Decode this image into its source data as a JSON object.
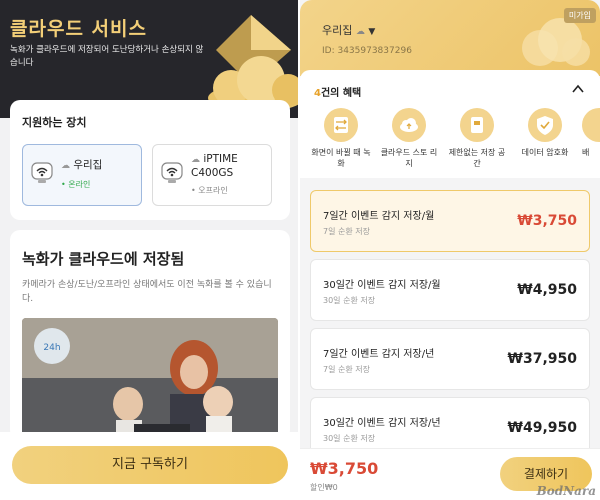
{
  "left": {
    "hero": {
      "title": "클라우드 서비스",
      "subtitle": "녹화가 클라우드에 저장되어 도난당하거나 손상되지 않습니다"
    },
    "devices": {
      "heading": "지원하는 장치",
      "items": [
        {
          "name": "우리집",
          "status": "• 온라인",
          "selected": true
        },
        {
          "name_line1": "iPTIME",
          "name_line2": "C400GS",
          "status": "• 오프라인",
          "selected": false
        }
      ]
    },
    "cloud": {
      "title": "녹화가 클라우드에 저장됨",
      "desc": "카메라가 손상/도난/오프라인 상태에서도 이전 녹화를 볼 수 있습니다.",
      "badge": "24h"
    },
    "subscribe_label": "지금 구독하기"
  },
  "right": {
    "home": {
      "name": "우리집",
      "id": "ID: 3435973837296"
    },
    "unsubscribed_badge": "미가입",
    "benefits": {
      "count": "4",
      "heading_suffix": "건의 혜택",
      "items": [
        {
          "icon": "swap-icon",
          "label": "화면이 바뀔 때 녹화"
        },
        {
          "icon": "cloud-storage-icon",
          "label": "클라우드 스토 리지"
        },
        {
          "icon": "unlimited-storage-icon",
          "label": "제한없는 저장 공간"
        },
        {
          "icon": "encryption-shield-icon",
          "label": "데이터 암호화"
        },
        {
          "icon": "more-icon",
          "label": "배"
        }
      ]
    },
    "plans": [
      {
        "name": "7일간 이벤트 감지 저장/월",
        "sub": "7일 순환 저장",
        "price": "₩3,750",
        "selected": true
      },
      {
        "name": "30일간 이벤트 감지 저장/월",
        "sub": "30일 순환 저장",
        "price": "₩4,950",
        "selected": false
      },
      {
        "name": "7일간 이벤트 감지 저장/년",
        "sub": "7일 순환 저장",
        "price": "₩37,950",
        "selected": false
      },
      {
        "name": "30일간 이벤트 감지 저장/년",
        "sub": "30일 순환 저장",
        "price": "₩49,950",
        "selected": false
      }
    ],
    "total": "₩3,750",
    "discount": "할인₩0",
    "pay_label": "결제하기",
    "watermark": "BodNara"
  },
  "colors": {
    "accent_gold": "#efc55c",
    "price_red": "#d94a36",
    "online_green": "#2fa84a"
  }
}
